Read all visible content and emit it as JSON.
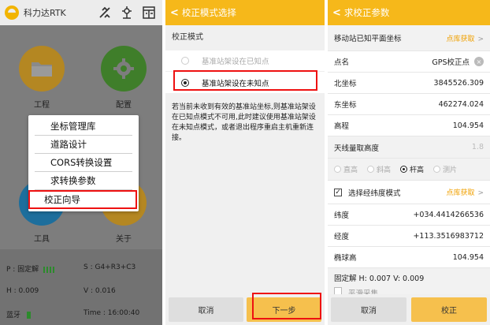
{
  "panel1": {
    "app_title": "科力达RTK",
    "tiles": [
      {
        "label": "工程",
        "color": "#f4b82a",
        "icon": "folder-icon"
      },
      {
        "label": "配置",
        "color": "#5ab53c",
        "icon": "gear-icon"
      },
      {
        "label": "工具",
        "color": "#1e9ce6",
        "icon": "tools-icon"
      },
      {
        "label": "关于",
        "color": "#f4b82a",
        "icon": "info-icon"
      }
    ],
    "menu": [
      "坐标管理库",
      "道路设计",
      "CORS转换设置",
      "求转换参数",
      "校正向导"
    ],
    "status": {
      "solution": "P : 固定解",
      "sats": "S : G4+R3+C3",
      "h": "H : 0.009",
      "v": "V : 0.016",
      "bluetooth": "蓝牙",
      "time": "Time : 16:00:40"
    }
  },
  "panel2": {
    "title": "校正模式选择",
    "section": "校正模式",
    "options": [
      "基准站架设在已知点",
      "基准站架设在未知点"
    ],
    "note": "若当前未收到有效的基准站坐标,则基准站架设在已知点模式不可用,此时建议使用基准站架设在未知点模式，或者退出程序重启主机重新连接。",
    "cancel": "取消",
    "next": "下一步"
  },
  "panel3": {
    "title": "求校正参数",
    "known_coord_label": "移动站已知平面坐标",
    "point_lib_link": "点库获取",
    "point_name_label": "点名",
    "point_name_value": "GPS校正点",
    "north_label": "北坐标",
    "north_value": "3845526.309",
    "east_label": "东坐标",
    "east_value": "462274.024",
    "elev_label": "高程",
    "elev_value": "104.954",
    "antenna_label": "天线量取高度",
    "antenna_value": "1.8",
    "antenna_modes": [
      "直高",
      "斜高",
      "杆高",
      "测片"
    ],
    "latlon_mode_label": "选择经纬度模式",
    "lat_label": "纬度",
    "lat_value": "+034.4414266536",
    "lon_label": "经度",
    "lon_value": "+113.3516983712",
    "ellip_label": "椭球高",
    "ellip_value": "104.954",
    "fix_status": "固定解   H: 0.007   V: 0.009",
    "smooth_label": "平滑采集",
    "cancel": "取消",
    "calibrate": "校正"
  },
  "colors": {
    "accent": "#f6b81a",
    "highlight": "#e11111",
    "link": "#f0a000"
  }
}
